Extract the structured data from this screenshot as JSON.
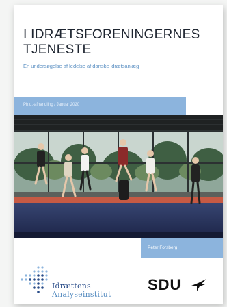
{
  "cover": {
    "title_line1": "I IDRÆTSFORENINGERNES",
    "title_line2": "TJENESTE",
    "subtitle": "En undersøgelse af ledelse af danske idrætsanlæg",
    "band_text": "Ph.d.-afhandling / Januar 2020",
    "author": "Peter Forsberg"
  },
  "logos": {
    "institute_line1": "Idrættens",
    "institute_line2": "Analyseinstitut",
    "university": "SDU"
  },
  "colors": {
    "band": "#8cb4dd",
    "title": "#1e2530",
    "subtitle": "#5a8fc2",
    "institute_dark": "#2b4e8a",
    "institute_light": "#5a8fc2"
  },
  "icons": [
    "dot-grid-logo-icon",
    "sdu-bird-icon"
  ]
}
